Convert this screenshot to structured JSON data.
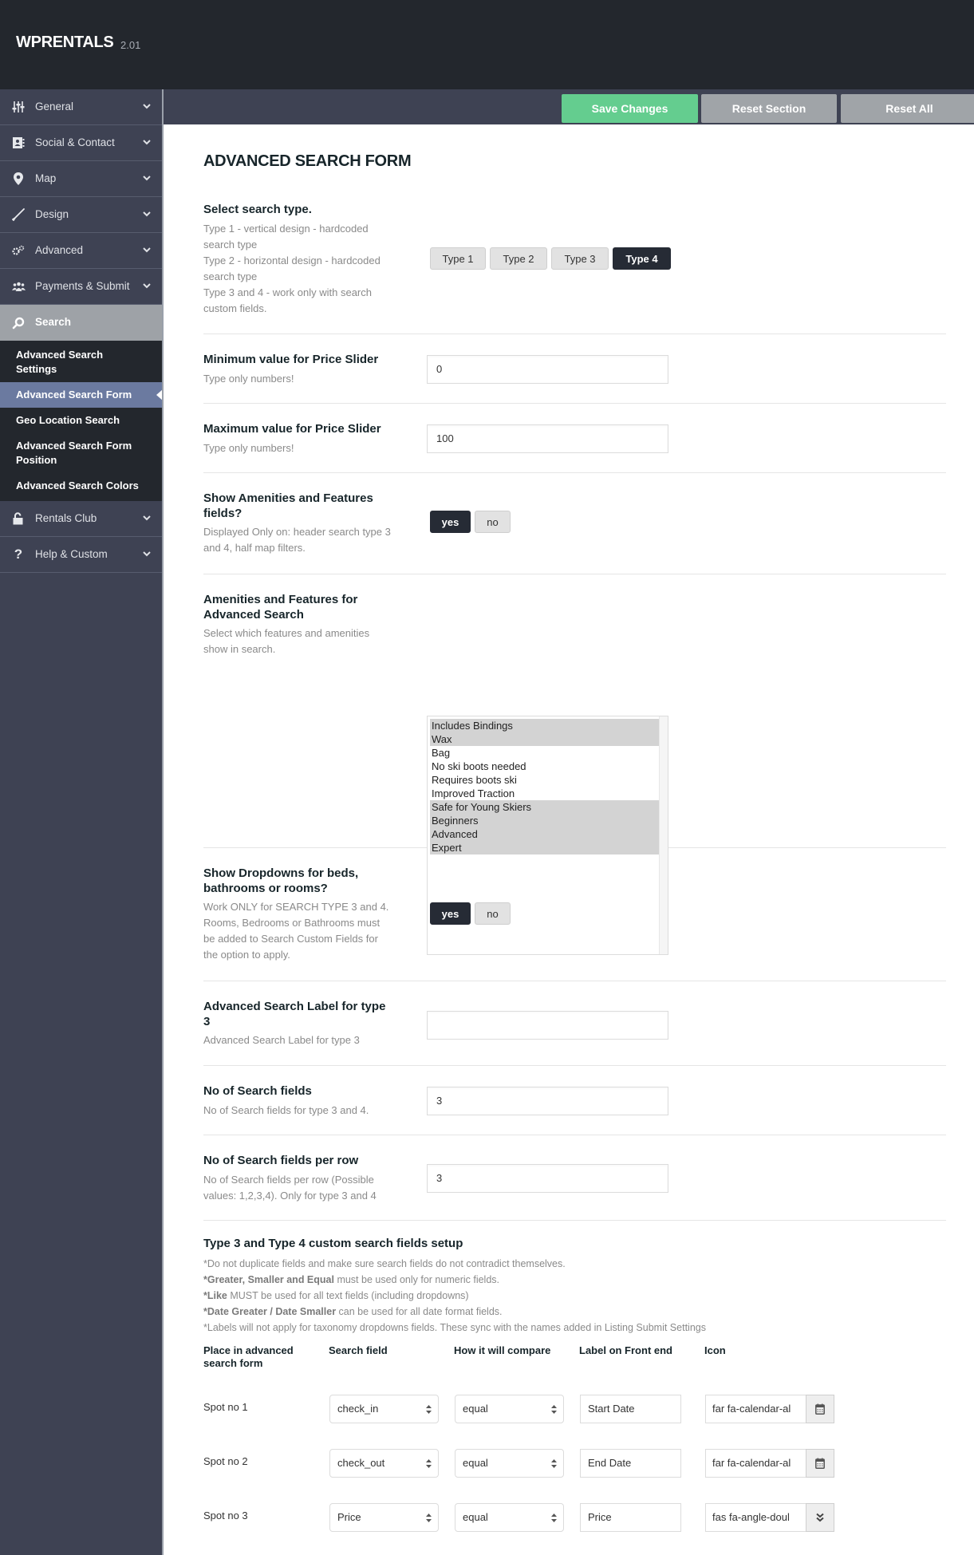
{
  "header": {
    "logo": "WPRENTALS",
    "version": "2.01"
  },
  "sidebar": {
    "items": [
      {
        "label": "General",
        "icon": "sliders-icon"
      },
      {
        "label": "Social & Contact",
        "icon": "contact-card-icon"
      },
      {
        "label": "Map",
        "icon": "map-marker-icon"
      },
      {
        "label": "Design",
        "icon": "brush-icon"
      },
      {
        "label": "Advanced",
        "icon": "cogs-icon"
      },
      {
        "label": "Payments & Submit",
        "icon": "users-icon"
      },
      {
        "label": "Search",
        "icon": "search-icon"
      },
      {
        "label": "Rentals Club",
        "icon": "unlock-icon"
      },
      {
        "label": "Help & Custom",
        "icon": "question-icon"
      }
    ],
    "search_submenu": [
      "Advanced Search Settings",
      "Advanced Search Form",
      "Geo Location Search",
      "Advanced Search Form Position",
      "Advanced Search Colors"
    ],
    "active_submenu": "Advanced Search Form"
  },
  "toolbar": {
    "save_label": "Save Changes",
    "reset_section_label": "Reset Section",
    "reset_all_label": "Reset All",
    "save_color": "#64cd8f"
  },
  "page": {
    "title": "ADVANCED SEARCH FORM",
    "search_type": {
      "title": "Select search type.",
      "desc": "Type 1 - vertical design - hardcoded search type\nType 2 - horizontal design - hardcoded search type\nType 3 and 4 - work only with search custom fields.",
      "desc_lines": [
        "Type 1 - vertical design - hardcoded",
        "search type",
        "Type 2 - horizontal design - hardcoded",
        "search type",
        "Type 3 and 4 - work only with search",
        "custom fields."
      ],
      "options": [
        "Type 1",
        "Type 2",
        "Type 3",
        "Type 4"
      ],
      "selected": "Type 4"
    },
    "min_price": {
      "title": "Minimum value for Price Slider",
      "desc": "Type only numbers!",
      "value": "0"
    },
    "max_price": {
      "title": "Maximum value for Price Slider",
      "desc": "Type only numbers!",
      "value": "100"
    },
    "show_amenities": {
      "title_lines": [
        "Show Amenities and Features",
        "fields?"
      ],
      "desc_lines": [
        "Displayed Only on: header search type 3",
        "and 4, half map filters."
      ],
      "yes": "yes",
      "no": "no",
      "selected": "yes"
    },
    "amenities": {
      "title_lines": [
        "Amenities and Features for",
        "Advanced Search"
      ],
      "desc_lines": [
        "Select which features and amenities",
        "show in search."
      ],
      "options": [
        {
          "label": "Includes Bindings",
          "selected": true
        },
        {
          "label": "Wax",
          "selected": true
        },
        {
          "label": "Bag",
          "selected": false
        },
        {
          "label": "No ski boots needed",
          "selected": false
        },
        {
          "label": "Requires boots ski",
          "selected": false
        },
        {
          "label": "Improved Traction",
          "selected": false
        },
        {
          "label": "Safe for Young Skiers",
          "selected": true
        },
        {
          "label": "Beginners",
          "selected": true
        },
        {
          "label": "Advanced",
          "selected": true
        },
        {
          "label": "Expert",
          "selected": true
        }
      ]
    },
    "show_dropdowns": {
      "title_lines": [
        "Show Dropdowns for beds,",
        "bathrooms or rooms?"
      ],
      "desc_lines": [
        "Work ONLY for SEARCH TYPE 3 and 4.",
        "Rooms, Bedrooms or Bathrooms must",
        "be added to Search Custom Fields for",
        "the option to apply."
      ],
      "yes": "yes",
      "no": "no",
      "selected": "yes"
    },
    "label_type3": {
      "title_lines": [
        "Advanced Search Label for type",
        "3"
      ],
      "desc": "Advanced Search Label for type 3",
      "value": ""
    },
    "no_fields": {
      "title": "No of Search fields",
      "desc": "No of Search fields for type 3 and 4.",
      "value": "3"
    },
    "fields_per_row": {
      "title": "No of Search fields per row",
      "desc_lines": [
        "No of Search fields per row (Possible",
        "values: 1,2,3,4). Only for type 3 and 4"
      ],
      "value": "3"
    },
    "custom_fields": {
      "title": "Type 3 and Type 4 custom search fields setup",
      "notes": [
        {
          "bold": "",
          "text": "*Do not duplicate fields and make sure search fields do not contradict themselves."
        },
        {
          "bold": "*Greater, Smaller and Equal",
          "text": " must be used only for numeric fields."
        },
        {
          "bold": "*Like",
          "text": " MUST be used for all text fields (including dropdowns)"
        },
        {
          "bold": "*Date Greater / Date Smaller",
          "text": " can be used for all date format fields."
        },
        {
          "bold": "",
          "text": "*Labels will not apply for taxonomy dropdowns fields. These sync with the names added in Listing Submit Settings"
        }
      ],
      "columns": [
        "Place in advanced search form",
        "Search field",
        "How it will compare",
        "Label on Front end",
        "Icon"
      ],
      "rows": [
        {
          "place": "Spot no 1",
          "field": "check_in",
          "compare": "equal",
          "label": "Start Date",
          "icon": "far fa-calendar-al",
          "icon_glyph": "calendar-icon"
        },
        {
          "place": "Spot no 2",
          "field": "check_out",
          "compare": "equal",
          "label": "End Date",
          "icon": "far fa-calendar-al",
          "icon_glyph": "calendar-icon"
        },
        {
          "place": "Spot no 3",
          "field": "Price",
          "compare": "equal",
          "label": "Price",
          "icon": "fas fa-angle-doul",
          "icon_glyph": "angle-double-down-icon"
        }
      ]
    }
  }
}
